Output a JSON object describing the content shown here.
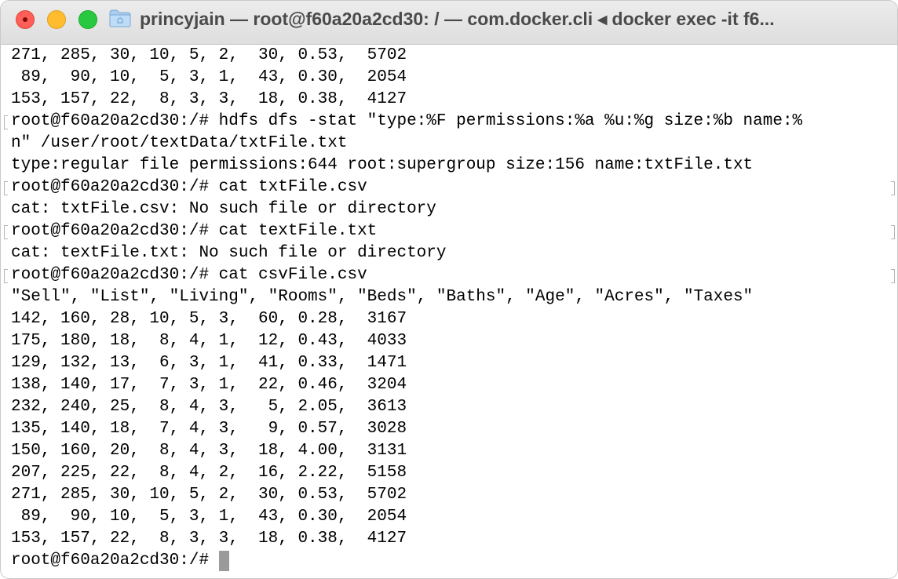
{
  "window": {
    "title": "princyjain — root@f60a20a2cd30: / — com.docker.cli ◂ docker exec -it f6..."
  },
  "icons": {
    "close": "close-dot-icon",
    "minimize": "minimize-icon",
    "zoom": "zoom-icon",
    "folder": "folder-icon",
    "cursor": "terminal-cursor-icon"
  },
  "colors": {
    "close": "#ff5f57",
    "minimize": "#febc2e",
    "zoom": "#28c840",
    "text": "#000000",
    "title_text": "#4a4a4a",
    "cursor": "#9a9a9a"
  },
  "terminal": {
    "lines": [
      "271, 285, 30, 10, 5, 2,  30, 0.53,  5702",
      " 89,  90, 10,  5, 3, 1,  43, 0.30,  2054",
      "153, 157, 22,  8, 3, 3,  18, 0.38,  4127",
      "root@f60a20a2cd30:/# hdfs dfs -stat \"type:%F permissions:%a %u:%g size:%b name:%",
      "n\" /user/root/textData/txtFile.txt",
      "type:regular file permissions:644 root:supergroup size:156 name:txtFile.txt",
      "root@f60a20a2cd30:/# cat txtFile.csv",
      "cat: txtFile.csv: No such file or directory",
      "root@f60a20a2cd30:/# cat textFile.txt",
      "cat: textFile.txt: No such file or directory",
      "root@f60a20a2cd30:/# cat csvFile.csv",
      "\"Sell\", \"List\", \"Living\", \"Rooms\", \"Beds\", \"Baths\", \"Age\", \"Acres\", \"Taxes\"",
      "142, 160, 28, 10, 5, 3,  60, 0.28,  3167",
      "175, 180, 18,  8, 4, 1,  12, 0.43,  4033",
      "129, 132, 13,  6, 3, 1,  41, 0.33,  1471",
      "138, 140, 17,  7, 3, 1,  22, 0.46,  3204",
      "232, 240, 25,  8, 4, 3,   5, 2.05,  3613",
      "135, 140, 18,  7, 4, 3,   9, 0.57,  3028",
      "150, 160, 20,  8, 4, 3,  18, 4.00,  3131",
      "207, 225, 22,  8, 4, 2,  16, 2.22,  5158",
      "271, 285, 30, 10, 5, 2,  30, 0.53,  5702",
      " 89,  90, 10,  5, 3, 1,  43, 0.30,  2054",
      "153, 157, 22,  8, 3, 3,  18, 0.38,  4127"
    ],
    "prompt": "root@f60a20a2cd30:/# "
  }
}
